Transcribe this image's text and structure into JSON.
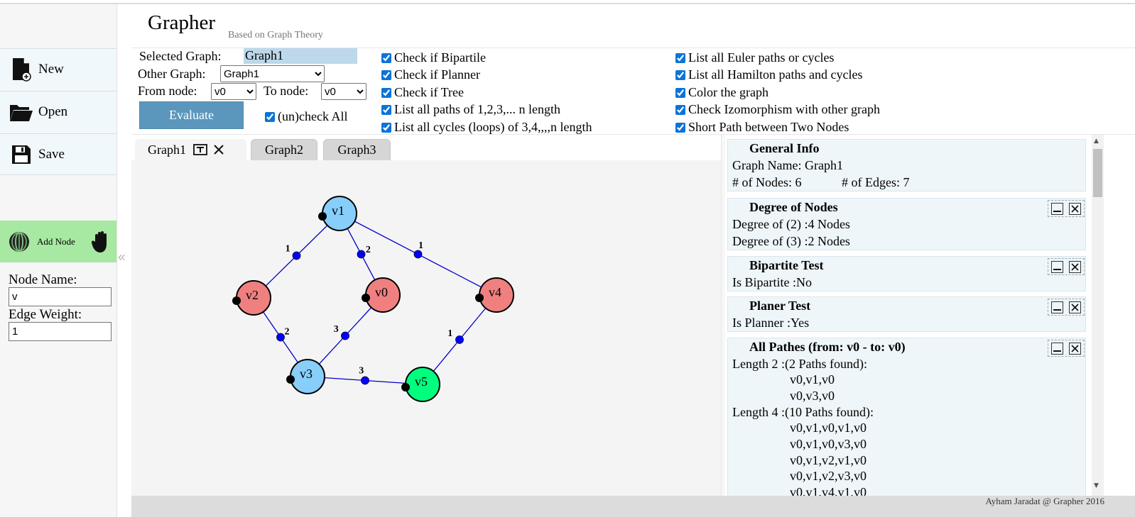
{
  "app": {
    "title": "Grapher",
    "subtitle": "Based on Graph Theory"
  },
  "sidebar": {
    "new_label": "New",
    "open_label": "Open",
    "save_label": "Save",
    "add_node_label": "Add Node",
    "node_name_label": "Node Name:",
    "node_name_value": "v",
    "edge_weight_label": "Edge Weight:",
    "edge_weight_value": "1"
  },
  "controls": {
    "selected_graph_label": "Selected Graph:",
    "selected_graph_value": "Graph1",
    "other_graph_label": "Other Graph:",
    "other_graph_value": "Graph1",
    "from_node_label": "From node:",
    "from_node_value": "v0",
    "to_node_label": "To node:",
    "to_node_value": "v0",
    "evaluate_label": "Evaluate",
    "uncheck_all_label": "(un)check All",
    "checks_col1": [
      "Check if Bipartile",
      "Check if Planner",
      "Check if Tree",
      "List all paths of 1,2,3,... n length",
      "List all cycles (loops) of 3,4,,,,n length"
    ],
    "checks_col2": [
      "List all Euler paths or cycles",
      "List all Hamilton paths and cycles",
      "Color the graph",
      "Check Izomorphism with other graph",
      "Short Path between Two Nodes"
    ]
  },
  "tabs": [
    {
      "label": "Graph1"
    },
    {
      "label": "Graph2"
    },
    {
      "label": "Graph3"
    }
  ],
  "graph": {
    "nodes": [
      {
        "id": "v1",
        "label": "v1",
        "color": "#87cefa"
      },
      {
        "id": "v2",
        "label": "v2",
        "color": "#f08080"
      },
      {
        "id": "v0",
        "label": "v0",
        "color": "#f08080"
      },
      {
        "id": "v4",
        "label": "v4",
        "color": "#f08080"
      },
      {
        "id": "v3",
        "label": "v3",
        "color": "#87cefa"
      },
      {
        "id": "v5",
        "label": "v5",
        "color": "#00ff7f"
      }
    ],
    "edges": [
      {
        "from": "v1",
        "to": "v2",
        "weight": "1"
      },
      {
        "from": "v1",
        "to": "v0",
        "weight": "2"
      },
      {
        "from": "v1",
        "to": "v4",
        "weight": "1"
      },
      {
        "from": "v2",
        "to": "v3",
        "weight": "2"
      },
      {
        "from": "v0",
        "to": "v3",
        "weight": "3"
      },
      {
        "from": "v3",
        "to": "v5",
        "weight": "3"
      },
      {
        "from": "v4",
        "to": "v5",
        "weight": "1"
      }
    ],
    "edge_color": "#0000cd",
    "handle_color": "#0000ff"
  },
  "info": {
    "general": {
      "title": "General Info",
      "graph_name": "Graph Name: Graph1",
      "nodes_count": "# of Nodes: 6",
      "edges_count": "# of Edges: 7"
    },
    "degree": {
      "title": "Degree of Nodes",
      "lines": [
        "Degree of (2) :4 Nodes",
        "Degree of (3) :2 Nodes"
      ]
    },
    "bipartite": {
      "title": "Bipartite Test",
      "line": "Is Bipartite :No"
    },
    "planer": {
      "title": "Planer Test",
      "line": "Is Planner :Yes"
    },
    "paths": {
      "title": "All Pathes (from: v0 - to: v0)",
      "length2_header": "Length 2 :(2 Paths found):",
      "length2": [
        "v0,v1,v0",
        "v0,v3,v0"
      ],
      "length4_header": "Length 4 :(10 Paths found):",
      "length4": [
        "v0,v1,v0,v1,v0",
        "v0,v1,v0,v3,v0",
        "v0,v1,v2,v1,v0",
        "v0,v1,v2,v3,v0",
        "v0,v1,v4,v1,v0"
      ]
    }
  },
  "footer": {
    "text": "Ayham Jaradat @ Grapher 2016"
  }
}
